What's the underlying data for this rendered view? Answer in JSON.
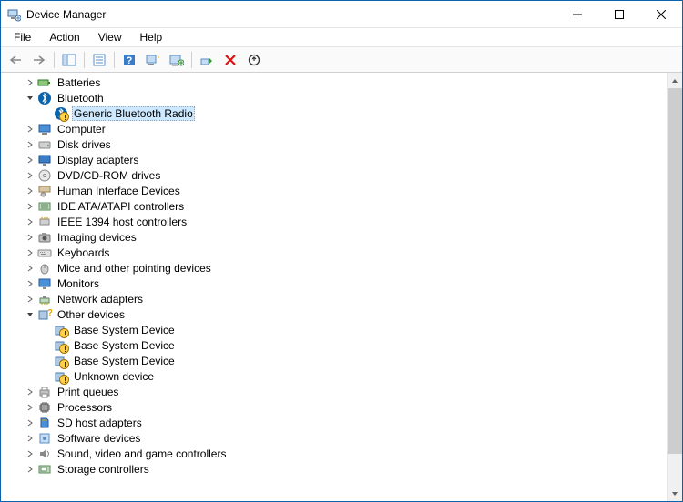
{
  "window": {
    "title": "Device Manager"
  },
  "menu": {
    "file": "File",
    "action": "Action",
    "view": "View",
    "help": "Help"
  },
  "tree": {
    "batteries": "Batteries",
    "bluetooth": "Bluetooth",
    "generic_bt_radio": "Generic Bluetooth Radio",
    "computer": "Computer",
    "disk_drives": "Disk drives",
    "display_adapters": "Display adapters",
    "dvd_cdrom": "DVD/CD-ROM drives",
    "hid": "Human Interface Devices",
    "ide_ata": "IDE ATA/ATAPI controllers",
    "ieee1394": "IEEE 1394 host controllers",
    "imaging": "Imaging devices",
    "keyboards": "Keyboards",
    "mice": "Mice and other pointing devices",
    "monitors": "Monitors",
    "network": "Network adapters",
    "other": "Other devices",
    "base_sys_1": "Base System Device",
    "base_sys_2": "Base System Device",
    "base_sys_3": "Base System Device",
    "unknown": "Unknown device",
    "print_queues": "Print queues",
    "processors": "Processors",
    "sd_host": "SD host adapters",
    "software_devices": "Software devices",
    "sound": "Sound, video and game controllers",
    "storage": "Storage controllers"
  }
}
